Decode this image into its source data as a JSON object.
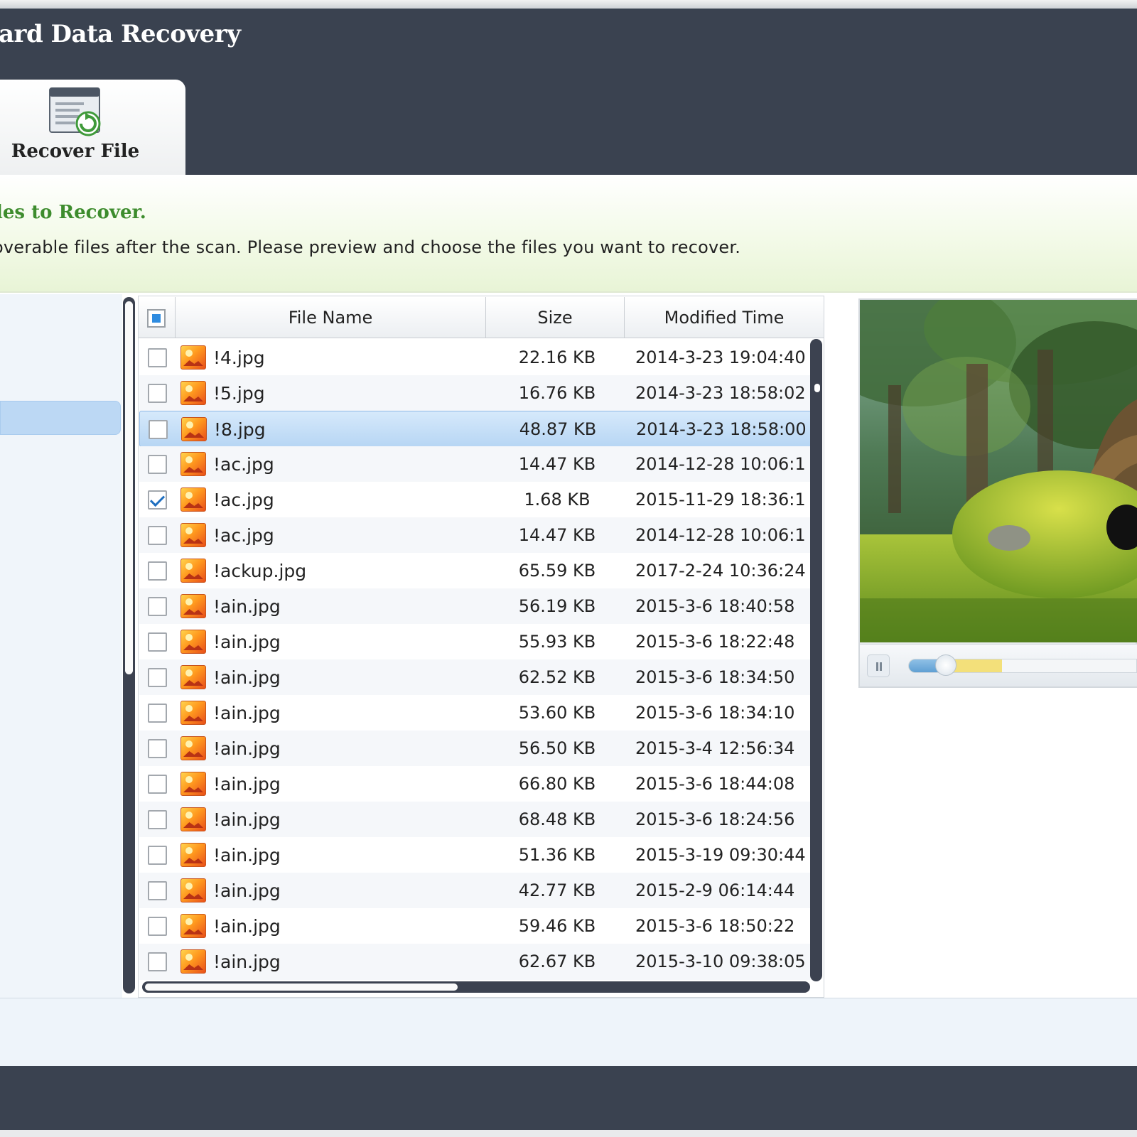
{
  "app": {
    "title": "ard Data Recovery"
  },
  "toolbar": {
    "recover_tab_label": "Recover File",
    "recover_tab_icon": "recover-file-icon"
  },
  "info": {
    "title": "les to Recover.",
    "description": "overable files after the scan. Please preview and choose the files you want to recover."
  },
  "table": {
    "columns": {
      "name": "File Name",
      "size": "Size",
      "modified": "Modified Time"
    },
    "select_all_state": "partial",
    "rows": [
      {
        "name": "!4.jpg",
        "size": "22.16 KB",
        "modified": "2014-3-23 19:04:40",
        "checked": false,
        "selected": false
      },
      {
        "name": "!5.jpg",
        "size": "16.76 KB",
        "modified": "2014-3-23 18:58:02",
        "checked": false,
        "selected": false
      },
      {
        "name": "!8.jpg",
        "size": "48.87 KB",
        "modified": "2014-3-23 18:58:00",
        "checked": false,
        "selected": true
      },
      {
        "name": "!ac.jpg",
        "size": "14.47 KB",
        "modified": "2014-12-28 10:06:1",
        "checked": false,
        "selected": false
      },
      {
        "name": "!ac.jpg",
        "size": "1.68 KB",
        "modified": "2015-11-29 18:36:1",
        "checked": true,
        "selected": false
      },
      {
        "name": "!ac.jpg",
        "size": "14.47 KB",
        "modified": "2014-12-28 10:06:1",
        "checked": false,
        "selected": false
      },
      {
        "name": "!ackup.jpg",
        "size": "65.59 KB",
        "modified": "2017-2-24 10:36:24",
        "checked": false,
        "selected": false
      },
      {
        "name": "!ain.jpg",
        "size": "56.19 KB",
        "modified": "2015-3-6 18:40:58",
        "checked": false,
        "selected": false
      },
      {
        "name": "!ain.jpg",
        "size": "55.93 KB",
        "modified": "2015-3-6 18:22:48",
        "checked": false,
        "selected": false
      },
      {
        "name": "!ain.jpg",
        "size": "62.52 KB",
        "modified": "2015-3-6 18:34:50",
        "checked": false,
        "selected": false
      },
      {
        "name": "!ain.jpg",
        "size": "53.60 KB",
        "modified": "2015-3-6 18:34:10",
        "checked": false,
        "selected": false
      },
      {
        "name": "!ain.jpg",
        "size": "56.50 KB",
        "modified": "2015-3-4 12:56:34",
        "checked": false,
        "selected": false
      },
      {
        "name": "!ain.jpg",
        "size": "66.80 KB",
        "modified": "2015-3-6 18:44:08",
        "checked": false,
        "selected": false
      },
      {
        "name": "!ain.jpg",
        "size": "68.48 KB",
        "modified": "2015-3-6 18:24:56",
        "checked": false,
        "selected": false
      },
      {
        "name": "!ain.jpg",
        "size": "51.36 KB",
        "modified": "2015-3-19 09:30:44",
        "checked": false,
        "selected": false
      },
      {
        "name": "!ain.jpg",
        "size": "42.77 KB",
        "modified": "2015-2-9 06:14:44",
        "checked": false,
        "selected": false
      },
      {
        "name": "!ain.jpg",
        "size": "59.46 KB",
        "modified": "2015-3-6 18:50:22",
        "checked": false,
        "selected": false
      },
      {
        "name": "!ain.jpg",
        "size": "62.67 KB",
        "modified": "2015-3-10 09:38:05",
        "checked": false,
        "selected": false
      }
    ]
  },
  "preview": {
    "image_subject": "forest-tree-scene",
    "player": {
      "pause_icon": "pause-icon",
      "played_fraction": 0.18,
      "buffered_fraction": 0.41
    }
  },
  "colors": {
    "header_bg": "#3a4250",
    "accent_green": "#3d8c2d",
    "selection_blue": "#b7d6f4",
    "checkbox_blue": "#2f8ce0"
  }
}
